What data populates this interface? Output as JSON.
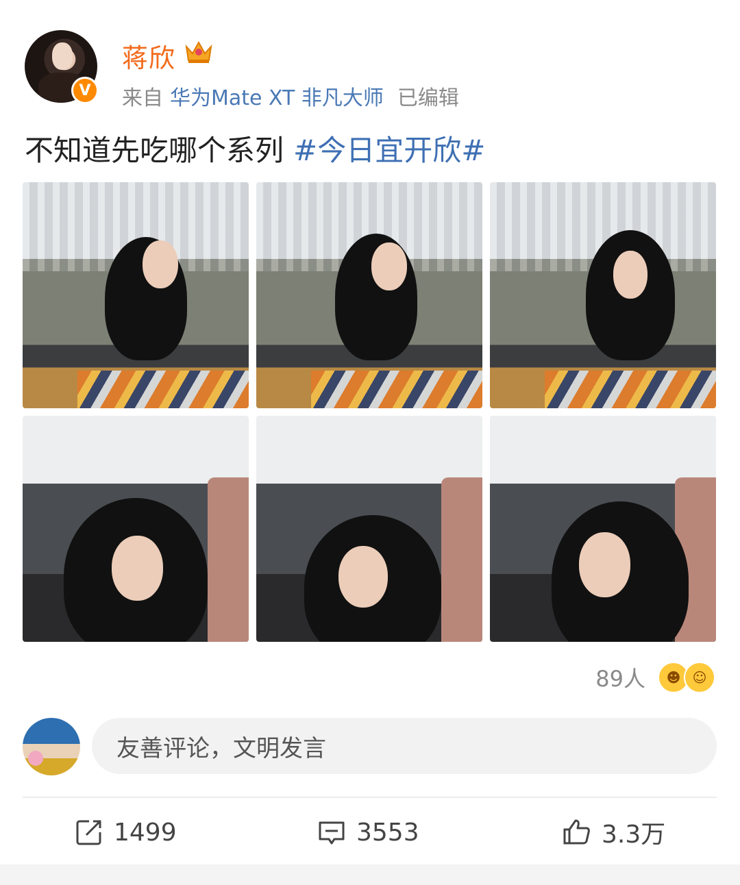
{
  "header": {
    "username": "蒋欣",
    "source_prefix": "来自",
    "device": "华为Mate XT 非凡大师",
    "edited": "已编辑",
    "verified_badge": "V",
    "crown_icon": "crown-icon"
  },
  "post": {
    "text": "不知道先吃哪个系列",
    "hashtag": "#今日宜开欣#",
    "photo_count": 6
  },
  "reactions": {
    "count": "89人"
  },
  "comment_input": {
    "placeholder": "友善评论，文明发言"
  },
  "actions": {
    "repost": "1499",
    "comment": "3553",
    "like": "3.3万"
  },
  "colors": {
    "username": "#f26a1b",
    "link": "#3e6fb3",
    "muted": "#8a8a8a",
    "verified": "#ff8a00"
  }
}
